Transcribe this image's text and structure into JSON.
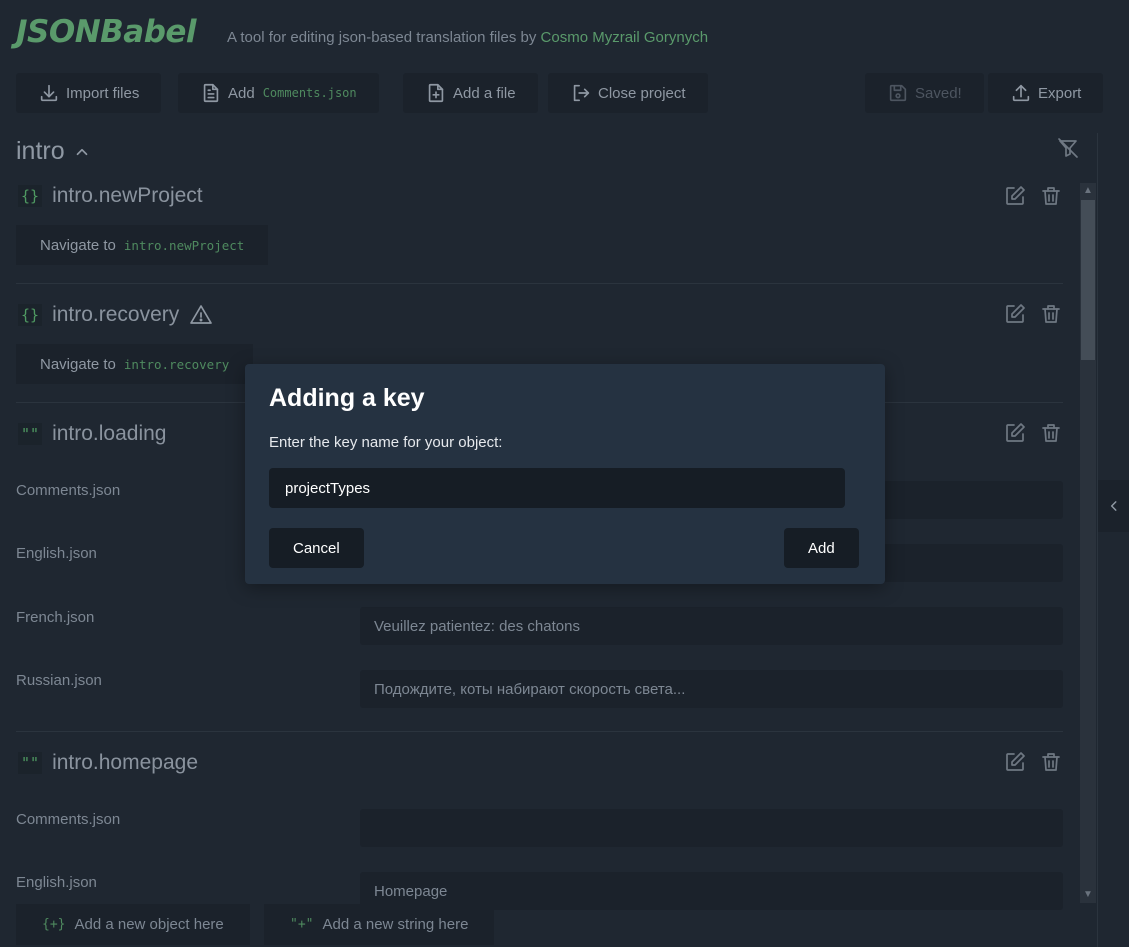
{
  "header": {
    "logo": "JSONBabel",
    "tagline": "A tool for editing json-based translation files by",
    "author": "Cosmo Myzrail Gorynych"
  },
  "toolbar": {
    "import_label": "Import files",
    "add_label": "Add",
    "add_file_code": "Comments.json",
    "add_a_file_label": "Add a file",
    "close_label": "Close project",
    "saved_label": "Saved!",
    "export_label": "Export"
  },
  "section": {
    "title": "intro"
  },
  "keys": [
    {
      "name": "intro.newProject",
      "glyph": "{}",
      "nav_label": "Navigate to",
      "nav_code": "intro.newProject"
    },
    {
      "name": "intro.recovery",
      "glyph": "{}",
      "nav_label": "Navigate to",
      "nav_code": "intro.recovery"
    },
    {
      "name": "intro.loading",
      "glyph": "\"\"",
      "rows": [
        {
          "lang": "Comments.json",
          "value": ""
        },
        {
          "lang": "English.json",
          "value": ""
        },
        {
          "lang": "French.json",
          "value": "Veuillez patientez: des chatons"
        },
        {
          "lang": "Russian.json",
          "value": "Подождите, коты набирают скорость света..."
        }
      ]
    },
    {
      "name": "intro.homepage",
      "glyph": "\"\"",
      "rows": [
        {
          "lang": "Comments.json",
          "value": ""
        },
        {
          "lang": "English.json",
          "value": "Homepage"
        }
      ]
    }
  ],
  "bottom": {
    "add_object_glyph": "{+}",
    "add_object_label": "Add a new object here",
    "add_string_glyph": "\"+\"",
    "add_string_label": "Add a new string here"
  },
  "modal": {
    "title": "Adding a key",
    "label": "Enter the key name for your object:",
    "input_value": "projectTypes",
    "cancel_label": "Cancel",
    "add_label": "Add"
  },
  "colors": {
    "background": "#1f2731",
    "panel": "#1b222b",
    "accent_green": "#5a9a6b",
    "modal_bg": "#253241"
  },
  "icons": {
    "import": "download-icon",
    "add": "document-icon",
    "add_file": "file-plus-icon",
    "close": "logout-icon",
    "saved": "save-icon",
    "export": "upload-icon",
    "filter": "filter-off-icon",
    "edit": "edit-icon",
    "delete": "trash-icon",
    "warning": "warning-icon"
  }
}
